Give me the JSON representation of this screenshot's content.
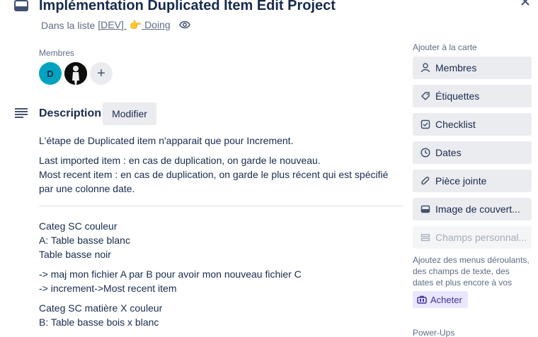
{
  "header": {
    "title": "Implémentation Duplicated Item Edit Project",
    "list_prefix": "Dans la liste",
    "list_name": "[DEV] ",
    "list_status": "Doing",
    "hand_emoji": "👉"
  },
  "members": {
    "label": "Membres",
    "avatar_initial": "D",
    "add_symbol": "+"
  },
  "description": {
    "title": "Description",
    "edit_label": "Modifier",
    "paragraphs": [
      "L'étape de Duplicated item n'apparait que pour Increment.",
      "Last imported item : en cas de duplication, on garde le nouveau.",
      "Most recent item : en cas de duplication, on garde le plus récent qui est spécifié par une colonne date.",
      "Categ SC couleur",
      "A: Table basse blanc",
      "Table basse noir",
      "-> maj mon fichier A par B pour avoir mon nouveau fichier C",
      "-> increment->Most recent item",
      "Categ SC matière X couleur",
      "B: Table basse bois x blanc"
    ]
  },
  "sidebar": {
    "heading": "Ajouter à la carte",
    "buttons": [
      {
        "label": "Membres",
        "icon": "person-icon"
      },
      {
        "label": "Étiquettes",
        "icon": "label-icon"
      },
      {
        "label": "Checklist",
        "icon": "checkbox-icon"
      },
      {
        "label": "Dates",
        "icon": "clock-icon"
      },
      {
        "label": "Pièce jointe",
        "icon": "paperclip-icon"
      },
      {
        "label": "Image de couvert...",
        "icon": "cover-icon"
      },
      {
        "label": "Champs personnal...",
        "icon": "fields-icon"
      }
    ],
    "help_text": "Ajoutez des menus déroulants, des champs de texte, des dates et plus encore à vos cartes.",
    "buy_label": "Acheter",
    "powerups_heading": "Power-Ups"
  },
  "colors": {
    "accent_avatar": "#00a3bf",
    "button_bg": "#ebecf0",
    "buy_bg": "#eae6ff"
  }
}
